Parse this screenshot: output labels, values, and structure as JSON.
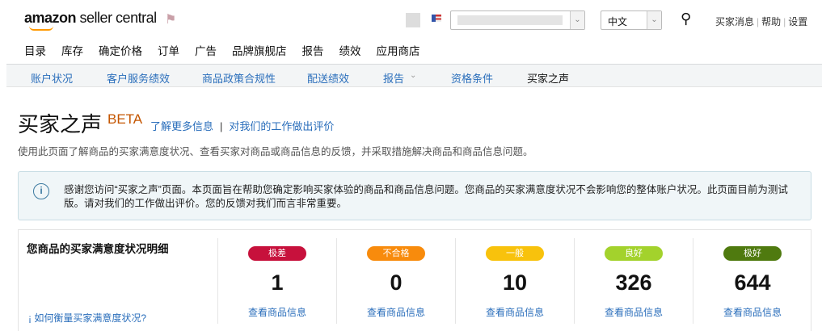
{
  "header": {
    "logo_brand": "amazon",
    "logo_product": "seller central",
    "language": "中文",
    "links": [
      "买家消息",
      "帮助",
      "设置"
    ]
  },
  "nav": [
    "目录",
    "库存",
    "确定价格",
    "订单",
    "广告",
    "品牌旗舰店",
    "报告",
    "绩效",
    "应用商店"
  ],
  "subnav": [
    "账户状况",
    "客户服务绩效",
    "商品政策合规性",
    "配送绩效",
    "报告",
    "资格条件",
    "买家之声"
  ],
  "page": {
    "title": "买家之声",
    "beta": "BETA",
    "learn_more": "了解更多信息",
    "sep": "|",
    "rate_us": "对我们的工作做出评价",
    "description": "使用此页面了解商品的买家满意度状况、查看买家对商品或商品信息的反馈，并采取措施解决商品和商品信息问题。"
  },
  "info": {
    "text": "感谢您访问“买家之声”页面。本页面旨在帮助您确定影响买家体验的商品和商品信息问题。您商品的买家满意度状况不会影响您的整体账户状况。此页面目前为测试版。请对我们的工作做出评价。您的反馈对我们而言非常重要。"
  },
  "summary": {
    "title": "您商品的买家满意度状况明细",
    "how_link": "如何衡量买家满意度状况?",
    "ratings": [
      {
        "label": "极差",
        "count": "1",
        "link": "查看商品信息",
        "color": "#c7113c"
      },
      {
        "label": "不合格",
        "count": "0",
        "link": "查看商品信息",
        "color": "#f88b0c"
      },
      {
        "label": "一般",
        "count": "10",
        "link": "查看商品信息",
        "color": "#f8c20c"
      },
      {
        "label": "良好",
        "count": "326",
        "link": "查看商品信息",
        "color": "#a3d22c"
      },
      {
        "label": "极好",
        "count": "644",
        "link": "查看商品信息",
        "color": "#4f7a0f"
      }
    ]
  }
}
